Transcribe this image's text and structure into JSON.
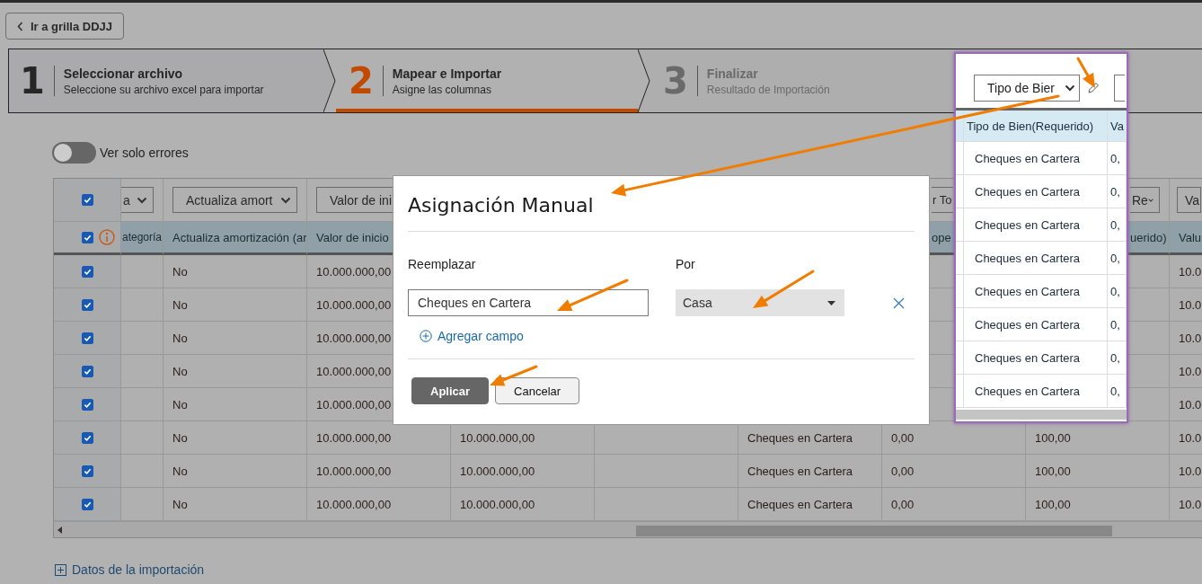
{
  "back_button": {
    "label": "Ir a grilla DDJJ"
  },
  "steps": [
    {
      "number": "1",
      "title": "Seleccionar archivo",
      "subtitle": "Seleccione su archivo excel para importar",
      "selected": false,
      "disabled": false
    },
    {
      "number": "2",
      "title": "Mapear e Importar",
      "subtitle": "Asigne las columnas",
      "selected": true,
      "disabled": false
    },
    {
      "number": "3",
      "title": "Finalizar",
      "subtitle": "Resultado de Importación",
      "selected": false,
      "disabled": true
    }
  ],
  "filter_toggle": {
    "label": "Ver solo errores",
    "on": false
  },
  "table": {
    "select_all_checked": true,
    "header_checked": true,
    "columns": {
      "column_2": {
        "select": "a",
        "header": "ategoría"
      },
      "column_3": {
        "select": "Actualiza amort",
        "header": "Actualiza amortización (ar"
      },
      "column_4": {
        "select": "Valor de ini",
        "header": "Valor de inicio"
      },
      "column_8": {
        "select": "r To",
        "header": "ope"
      },
      "column_9": {
        "select": "Re",
        "header": "uerido)"
      },
      "column_10": {
        "select": "Va",
        "header": "Valu"
      }
    },
    "rows": [
      {
        "checked": true,
        "column_3": "No",
        "column_4": "10.000.000,00",
        "column_10": "10.0"
      },
      {
        "checked": true,
        "column_3": "No",
        "column_4": "10.000.000,00",
        "column_10": "10.0"
      },
      {
        "checked": true,
        "column_3": "No",
        "column_4": "10.000.000,00",
        "column_10": "10.0"
      },
      {
        "checked": true,
        "column_3": "No",
        "column_4": "10.000.000,00",
        "column_10": "10.0"
      },
      {
        "checked": true,
        "column_3": "No",
        "column_4": "10.000.000,00",
        "column_10": "10.0"
      },
      {
        "checked": true,
        "column_3": "No",
        "column_4": "10.000.000,00",
        "column_5": "10.000.000,00",
        "column_7": "Cheques en Cartera",
        "column_8": "0,00",
        "column_9": "100,00",
        "column_10": "10.0"
      },
      {
        "checked": true,
        "column_3": "No",
        "column_4": "10.000.000,00",
        "column_5": "10.000.000,00",
        "column_7": "Cheques en Cartera",
        "column_8": "0,00",
        "column_9": "100,00",
        "column_10": "10.0"
      },
      {
        "checked": true,
        "column_3": "No",
        "column_4": "10.000.000,00",
        "column_5": "10.000.000,00",
        "column_7": "Cheques en Cartera",
        "column_8": "0,00",
        "column_9": "100,00",
        "column_10": "10.0"
      }
    ]
  },
  "footer_link": {
    "label": "Datos de la importación"
  },
  "modal": {
    "title": "Asignación Manual",
    "replace_label": "Reemplazar",
    "by_label": "Por",
    "replace_value": "Cheques en Cartera",
    "by_value": "Casa",
    "add_field": "Agregar campo",
    "buttons": [
      {
        "label": "Aplicar",
        "kind": "primary"
      },
      {
        "label": "Cancelar",
        "kind": "secondary"
      }
    ]
  },
  "inset": {
    "select": "Tipo de Bier",
    "headers": [
      "Tipo de Bien(Requerido)",
      "Va"
    ],
    "rows": [
      {
        "column_1": "Cheques en Cartera",
        "column_2": "0,"
      },
      {
        "column_1": "Cheques en Cartera",
        "column_2": "0,"
      },
      {
        "column_1": "Cheques en Cartera",
        "column_2": "0,"
      },
      {
        "column_1": "Cheques en Cartera",
        "column_2": "0,"
      },
      {
        "column_1": "Cheques en Cartera",
        "column_2": "0,"
      },
      {
        "column_1": "Cheques en Cartera",
        "column_2": "0,"
      },
      {
        "column_1": "Cheques en Cartera",
        "column_2": "0,"
      },
      {
        "column_1": "Cheques en Cartera",
        "column_2": "0,"
      }
    ]
  }
}
